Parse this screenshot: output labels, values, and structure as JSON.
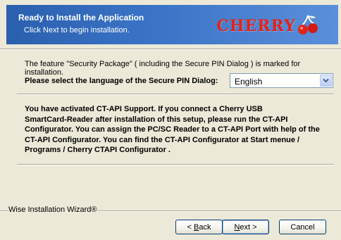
{
  "header": {
    "title": "Ready to Install the Application",
    "subtitle": "Click Next to begin installation.",
    "brand": "CHERRY"
  },
  "content": {
    "feature_text": "The feature \"Security Package\" ( including the Secure PIN Dialog ) is marked for installation.",
    "language_label": "Please select the language of the Secure PIN Dialog:",
    "language_selected": "English",
    "ctapi_lines": [
      "You have activated CT-API Support. If you connect a Cherry USB",
      "SmartCard-Reader after installation of this setup, please run the CT-API",
      "Configurator. You can assign the PC/SC Reader to a CT-API Port with help of the",
      "CT-API Configurator. You can find the CT-API Configurator at Start menue /",
      "Programs / Cherry CTAPI Configurator ."
    ]
  },
  "footer": {
    "wizard_label": "Wise Installation Wizard®",
    "back_prefix": "< ",
    "back_mnemonic": "B",
    "back_rest": "ack",
    "next_mnemonic": "N",
    "next_rest": "ext >",
    "cancel_label": "Cancel"
  },
  "colors": {
    "header_gradient_start": "#2a5fae",
    "header_gradient_end": "#5a8fda",
    "brand_red": "#e2231a",
    "dialog_bg": "#ece9d8"
  },
  "icons": {
    "brand_logo": "cherry-logo-icon",
    "dropdown": "chevron-down-icon"
  }
}
